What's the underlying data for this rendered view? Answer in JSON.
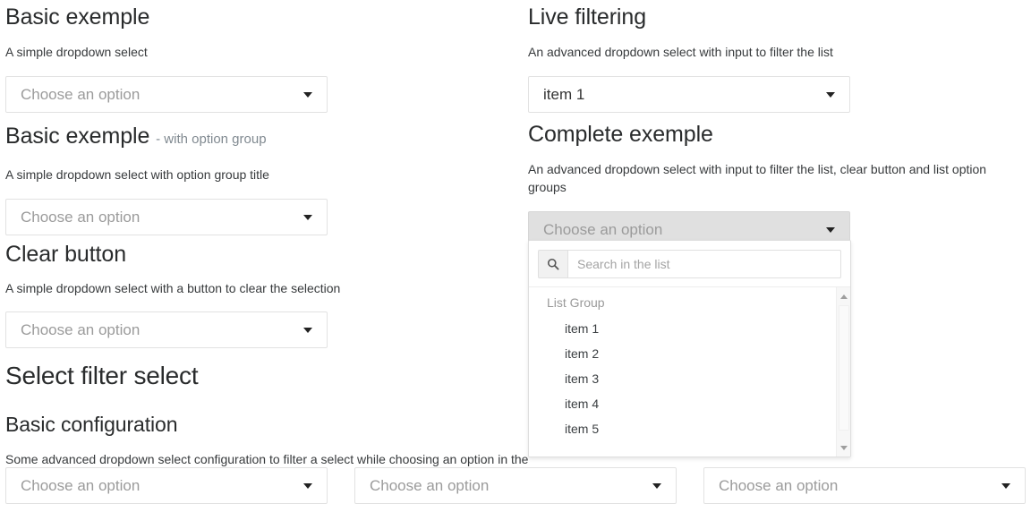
{
  "left_column": {
    "sections": [
      {
        "title": "Basic exemple",
        "subtitle": "",
        "description": "A simple dropdown select",
        "select": {
          "value": "Choose an option",
          "state": "placeholder",
          "caret": "chevron-down-icon"
        }
      },
      {
        "title": "Basic exemple",
        "subtitle": "- with option group",
        "description": "A simple dropdown select with option group title",
        "select": {
          "value": "Choose an option",
          "state": "placeholder",
          "caret": "chevron-down-icon"
        }
      },
      {
        "title": "Clear button",
        "subtitle": "",
        "description": "A simple dropdown select with a button to clear the selection",
        "select": {
          "value": "Choose an option",
          "state": "placeholder",
          "caret": "chevron-down-icon"
        }
      }
    ],
    "filter_section": {
      "heading": "Select filter select",
      "subheading": "Basic configuration",
      "description": "Some advanced dropdown select configuration to filter a select while choosing an option in the"
    }
  },
  "right_column": {
    "sections": [
      {
        "title": "Live filtering",
        "description": "An advanced dropdown select with input to filter the list",
        "select": {
          "value": "item 1",
          "state": "selected",
          "caret": "chevron-down-icon"
        }
      },
      {
        "title": "Complete exemple",
        "description": "An advanced dropdown select with input to filter the list, clear button and list option groups",
        "select": {
          "value": "Choose an option",
          "state": "placeholder-open",
          "caret": "chevron-down-icon"
        }
      }
    ]
  },
  "dropdown_panel": {
    "search": {
      "icon": "search-icon",
      "value": "",
      "placeholder": "Search in the list"
    },
    "group_label": "List Group",
    "options": [
      "item 1",
      "item 2",
      "item 3",
      "item 4",
      "item 5"
    ],
    "scrollbar": {
      "up_icon": "triangle-up-icon",
      "down_icon": "triangle-down-icon"
    }
  },
  "bottom_row": {
    "selects": [
      {
        "value": "Choose an option",
        "caret": "chevron-down-icon"
      },
      {
        "value": "Choose an option",
        "caret": "chevron-down-icon"
      },
      {
        "value": "Choose an option",
        "caret": "chevron-down-icon"
      }
    ]
  },
  "colors": {
    "text": "#292b2c",
    "muted": "#818a91",
    "placeholder": "#9b9b9b",
    "border": "#e2e2e2",
    "active_bg": "#e0e0e0"
  }
}
